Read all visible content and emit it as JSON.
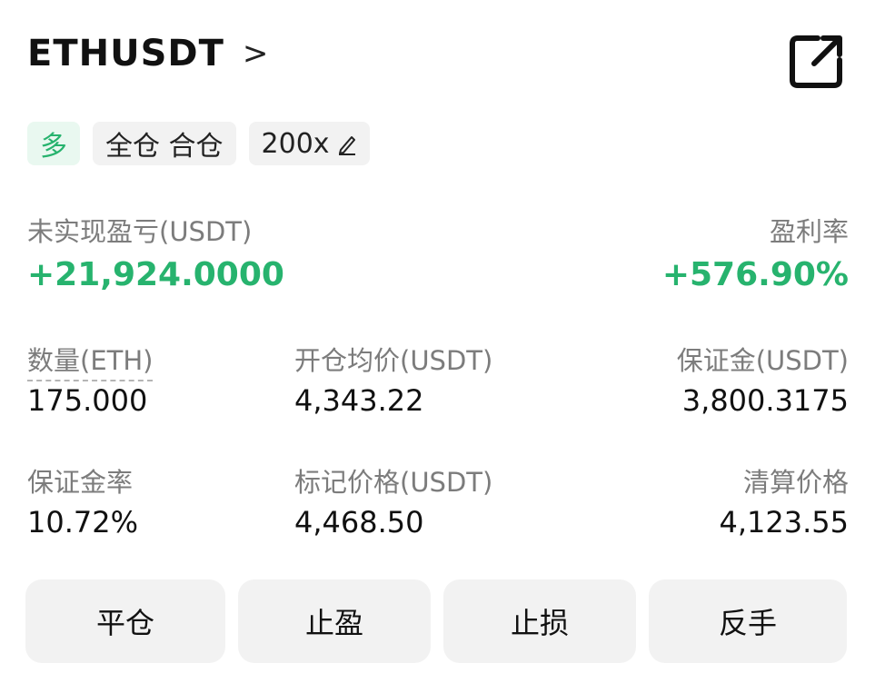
{
  "header": {
    "symbol": "ETHUSDT",
    "chevron": ">",
    "share_icon": "share-external-icon"
  },
  "tags": {
    "side": "多",
    "margin_mode": "全仓 合仓",
    "leverage": "200x"
  },
  "pnl": {
    "unrealized_label": "未实现盈亏(USDT)",
    "unrealized_value": "+21,924.0000",
    "roe_label": "盈利率",
    "roe_value": "+576.90%"
  },
  "stats": {
    "qty_label": "数量(ETH)",
    "qty_value": "175.000",
    "entry_label": "开仓均价(USDT)",
    "entry_value": "4,343.22",
    "margin_label": "保证金(USDT)",
    "margin_value": "3,800.3175",
    "margin_ratio_label": "保证金率",
    "margin_ratio_value": "10.72%",
    "mark_label": "标记价格(USDT)",
    "mark_value": "4,468.50",
    "liq_label": "清算价格",
    "liq_value": "4,123.55"
  },
  "actions": {
    "close": "平仓",
    "take_profit": "止盈",
    "stop_loss": "止损",
    "reverse": "反手"
  },
  "colors": {
    "profit_green": "#27b36e",
    "button_bg": "#f2f2f2"
  }
}
